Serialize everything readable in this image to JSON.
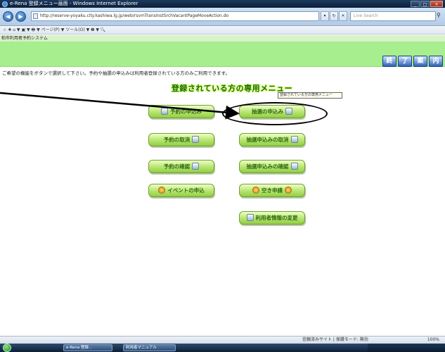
{
  "window": {
    "title": "e-Rena 登録メニュー画面 - Windows Internet Explorer",
    "controls": [
      "_",
      "□",
      "×"
    ]
  },
  "browser": {
    "address": "http://reserve-yoyaku.city.kashiwa.lg.jp/web/rsvmTransInstSrchVacantPageMoveAction.do",
    "search_placeholder": "Live Search",
    "command_bar": "☆ ✚  ⌂ ▼ ▣ ▼ 🖶 ▼ ページ(P) ▼ ツール(O) ▼ ❷ ▼ 🔍"
  },
  "page": {
    "title_strip": "柏市利用者予約システム",
    "top_buttons": [
      "終",
      "了",
      "案",
      "内"
    ],
    "instruction": "ご希望の機能をボタンで選択して下さい。予約や抽選の申込みは利用者登録されている方のみご利用できます。",
    "heading": "登録されている方の専用メニュー",
    "tooltip": "登録されている方の専用メニュー"
  },
  "menu": {
    "reserve_apply": "予約の申込み",
    "lottery_apply": "抽選の申込み",
    "reserve_cancel": "予約の取消",
    "lottery_cancel": "抽選申込みの取消",
    "reserve_confirm": "予約の確認",
    "lottery_confirm": "抽選申込みの確認",
    "event_apply": "イベントの申込",
    "unfilled_apply": "空き申請",
    "user_settings": "利用者情報の変更"
  },
  "status": {
    "zone": "信頼済みサイト | 保護モード: 無効",
    "zoom": "100%"
  },
  "taskbar": {
    "items": [
      "e-Rena 登録...",
      "利用者マニュアル"
    ]
  }
}
